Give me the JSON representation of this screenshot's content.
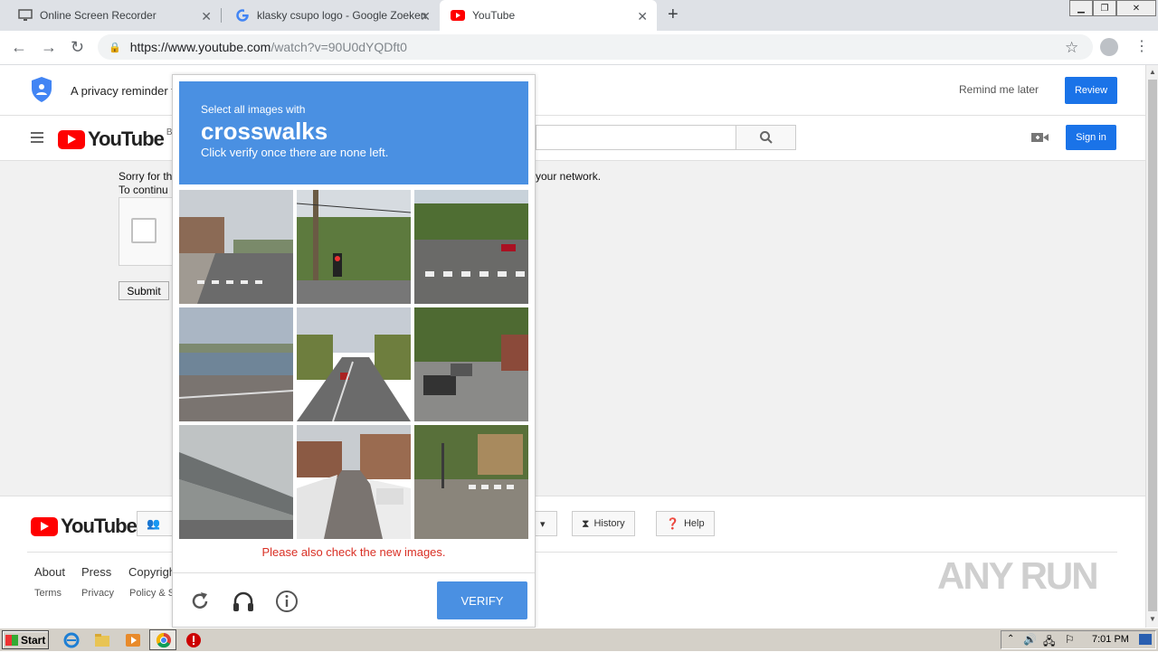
{
  "browser": {
    "tabs": [
      {
        "label": "Online Screen Recorder",
        "icon": "monitor-icon"
      },
      {
        "label": "klasky csupo logo - Google Zoeken",
        "icon": "google-icon"
      },
      {
        "label": "YouTube",
        "icon": "youtube-icon"
      }
    ],
    "new_tab": "+",
    "url_host": "https://www.youtube.com",
    "url_rest": "/watch?v=90U0dYQDft0"
  },
  "privacy": {
    "text": "A privacy reminder f",
    "remind_later": "Remind me later",
    "review": "Review"
  },
  "youtube": {
    "logo_text": "YouTube",
    "region": "BE",
    "sign_in": "Sign in"
  },
  "body": {
    "sorry_line1": "Sorry for th",
    "sorry_line2": "To continu",
    "sorry_right": "your network.",
    "submit": "Submit"
  },
  "captcha": {
    "instruction": "Select all images with",
    "target": "crosswalks",
    "subtext": "Click verify once there are none left.",
    "warning": "Please also check the new images.",
    "verify": "VERIFY",
    "tiles": [
      "crosswalk-street-tile",
      "traffic-light-tile",
      "crosswalk-intersection-tile",
      "waterfront-tile",
      "highway-tile",
      "parked-cars-tile",
      "overpass-tile",
      "snowy-street-tile",
      "crosswalk-corner-tile"
    ]
  },
  "footer": {
    "logo_text": "YouTube",
    "history": "History",
    "help": "Help",
    "links_row1": [
      "About",
      "Press",
      "Copyrigh"
    ],
    "links_row2": [
      "Terms",
      "Privacy",
      "Policy & S"
    ],
    "watermark": "ANY RUN"
  },
  "taskbar": {
    "start": "Start",
    "time": "7:01 PM"
  },
  "colors": {
    "accent": "#4a90e2",
    "button_blue": "#1a73e8",
    "youtube_red": "#ff0000",
    "warning_red": "#d93025"
  }
}
